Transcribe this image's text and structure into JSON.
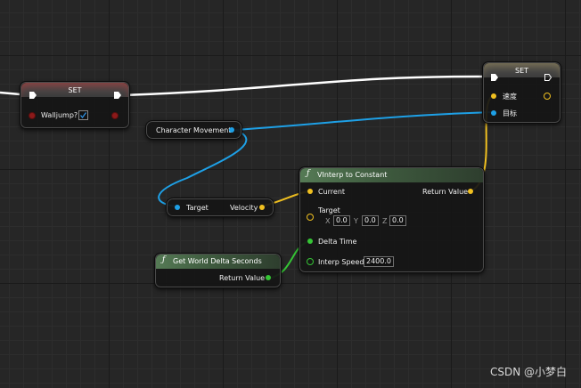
{
  "colors": {
    "exec": "#ffffff",
    "bool": "#8c1a1a",
    "object": "#1ea0e6",
    "vector": "#f0c020",
    "float": "#35c435",
    "grid": "#262626"
  },
  "nodes": {
    "set_walljump": {
      "title": "SET",
      "var_label": "Walljump?",
      "checked": true
    },
    "character_movement": {
      "label": "Character Movement"
    },
    "velocity_getter": {
      "target_label": "Target",
      "output_label": "Velocity"
    },
    "vinterp": {
      "fn_icon": "function-icon",
      "title": "VInterp to Constant",
      "current_label": "Current",
      "target_label": "Target",
      "x_label": "X",
      "x_value": "0.0",
      "y_label": "Y",
      "y_value": "0.0",
      "z_label": "Z",
      "z_value": "0.0",
      "delta_label": "Delta Time",
      "speed_label": "Interp Speed",
      "speed_value": "2400.0",
      "return_label": "Return Value"
    },
    "delta_seconds": {
      "fn_icon": "function-icon",
      "title": "Get World Delta Seconds",
      "return_label": "Return Value"
    },
    "set_velocity": {
      "title": "SET",
      "velocity_label": "速度",
      "target_label": "目标"
    }
  },
  "watermark": "CSDN @小梦白"
}
